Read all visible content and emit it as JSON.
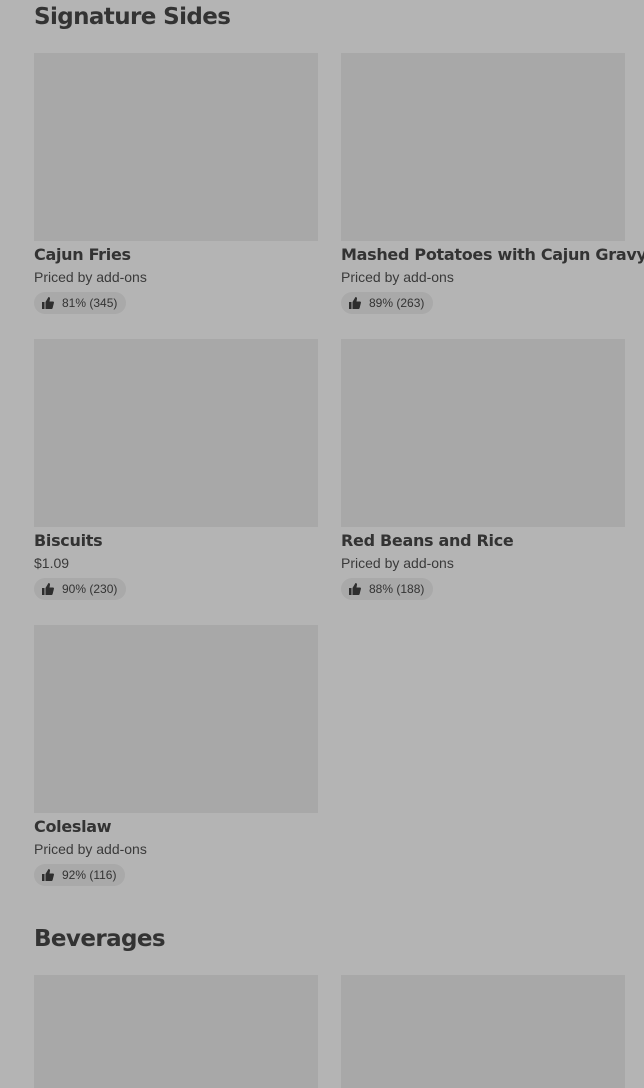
{
  "sections": {
    "sides_title": "Signature Sides",
    "beverages_title": "Beverages"
  },
  "items": [
    {
      "name": "Cajun Fries",
      "price": "Priced by add-ons",
      "rating": "81% (345)"
    },
    {
      "name": "Mashed Potatoes with Cajun Gravy",
      "price": "Priced by add-ons",
      "rating": "89% (263)"
    },
    {
      "name": "Biscuits",
      "price": "$1.09",
      "rating": "90% (230)"
    },
    {
      "name": "Red Beans and Rice",
      "price": "Priced by add-ons",
      "rating": "88% (188)"
    },
    {
      "name": "Coleslaw",
      "price": "Priced by add-ons",
      "rating": "92% (116)"
    }
  ],
  "icons": {
    "rating": "thumbs-up-icon"
  },
  "colors": {
    "overlay_bg": "#b4b4b4",
    "placeholder": "#a8a8a8",
    "pill": "#a9a9a9"
  }
}
